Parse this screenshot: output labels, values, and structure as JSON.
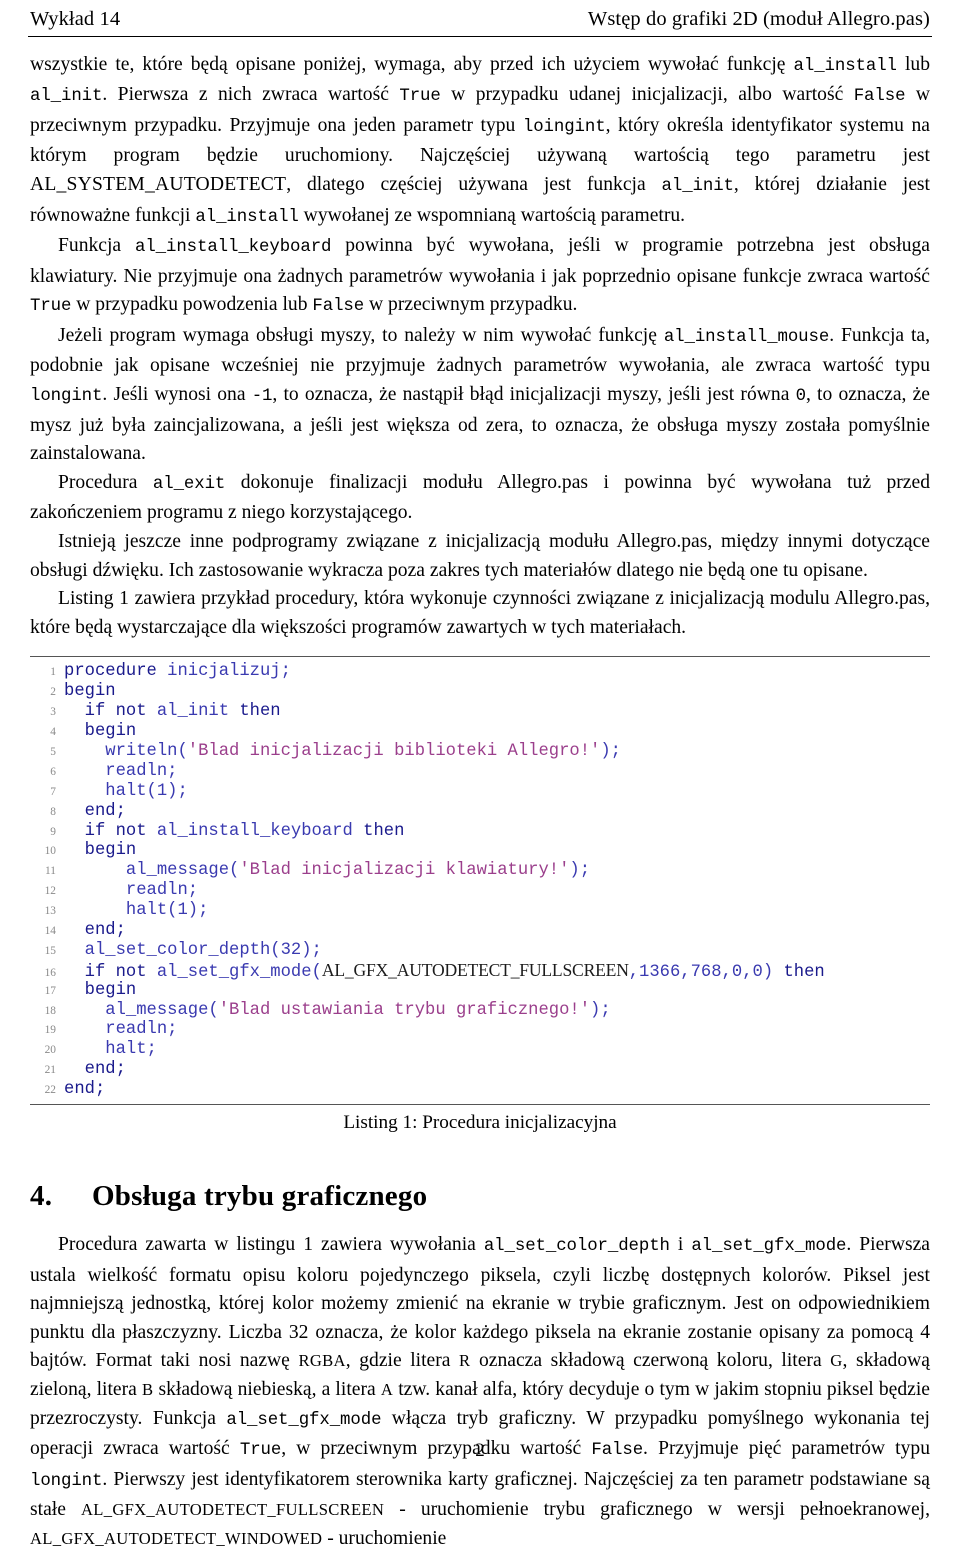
{
  "header": {
    "left": "Wykład 14",
    "right": "Wstęp do grafiki 2D (moduł Allegro.pas)"
  },
  "paragraphs": {
    "p1_a": "wszystkie te, które będą opisane poniżej, wymaga, aby przed ich użyciem wywołać funkcję ",
    "p1_code1": "al_install",
    "p1_b": " lub ",
    "p1_code2": "al_init",
    "p1_c": ". Pierwsza z nich zwraca wartość ",
    "p1_code3": "True",
    "p1_d": " w przypadku udanej inicjalizacji, albo wartość ",
    "p1_code4": "False",
    "p1_e": " w przeciwnym przypadku. Przyjmuje ona jeden parametr typu ",
    "p1_code5": "loingint",
    "p1_f": ", który określa identyfikator systemu na którym program będzie uruchomiony. Najczęściej używaną wartością tego parametru jest ",
    "p1_sc1": "AL_SYSTEM_AUTODETECT",
    "p1_g": ", dlatego częściej używana jest funkcja ",
    "p1_code6": "al_init",
    "p1_h": ", której działanie jest równoważne funkcji ",
    "p1_code7": "al_install",
    "p1_i": " wywołanej ze wspomnianą wartością parametru.",
    "p2_a": "Funkcja ",
    "p2_code1": "al_install_keyboard",
    "p2_b": " powinna być wywołana, jeśli w programie potrzebna jest obsługa klawiatury. Nie przyjmuje ona żadnych parametrów wywołania i jak poprzednio opisane funkcje zwraca wartość ",
    "p2_code2": "True",
    "p2_c": " w przypadku powodzenia lub ",
    "p2_code3": "False",
    "p2_d": " w przeciwnym przypadku.",
    "p3_a": "Jeżeli program wymaga obsługi myszy, to należy w nim wywołać funkcję ",
    "p3_code1": "al_install_mouse",
    "p3_b": ". Funkcja ta, podobnie jak opisane wcześniej nie przyjmuje żadnych parametrów wywołania, ale zwraca wartość typu ",
    "p3_code2": "longint",
    "p3_c": ". Jeśli wynosi ona ",
    "p3_code3": "-1",
    "p3_d": ", to oznacza, że nastąpił błąd inicjalizacji myszy, jeśli jest równa ",
    "p3_code4": "0",
    "p3_e": ", to oznacza, że mysz już była zaincjalizowana, a jeśli jest większa od zera, to oznacza, że obsługa myszy została pomyślnie zainstalowana.",
    "p4_a": "Procedura ",
    "p4_code1": "al_exit",
    "p4_b": " dokonuje finalizacji modułu Allegro.pas i powinna być wywołana tuż przed zakończeniem programu z niego korzystającego.",
    "p5": "Istnieją jeszcze inne podprogramy związane z inicjalizacją modułu Allegro.pas, między innymi dotyczące obsługi dźwięku. Ich zastosowanie wykracza poza zakres tych materiałów dlatego nie będą one tu opisane.",
    "p6": "Listing 1 zawiera przykład procedury, która wykonuje czynności związane z inicjalizacją modulu Allegro.pas, które będą wystarczające dla większości programów zawartych w tych materiałach."
  },
  "listing": {
    "caption": "Listing 1: Procedura inicjalizacyjna",
    "lines": [
      {
        "n": "1",
        "parts": [
          {
            "t": "procedure",
            "c": "kw"
          },
          {
            "t": " inicjalizuj;",
            "c": "idn"
          }
        ]
      },
      {
        "n": "2",
        "parts": [
          {
            "t": "begin",
            "c": "kw"
          }
        ]
      },
      {
        "n": "3",
        "parts": [
          {
            "t": "  ",
            "c": "pln"
          },
          {
            "t": "if not",
            "c": "kw"
          },
          {
            "t": " al_init ",
            "c": "idn"
          },
          {
            "t": "then",
            "c": "kw"
          }
        ]
      },
      {
        "n": "4",
        "parts": [
          {
            "t": "  ",
            "c": "pln"
          },
          {
            "t": "begin",
            "c": "kw"
          }
        ]
      },
      {
        "n": "5",
        "parts": [
          {
            "t": "    ",
            "c": "pln"
          },
          {
            "t": "writeln(",
            "c": "idn"
          },
          {
            "t": "'Blad inicjalizacji biblioteki Allegro!'",
            "c": "str"
          },
          {
            "t": ");",
            "c": "idn"
          }
        ]
      },
      {
        "n": "6",
        "parts": [
          {
            "t": "    ",
            "c": "pln"
          },
          {
            "t": "readln;",
            "c": "idn"
          }
        ]
      },
      {
        "n": "7",
        "parts": [
          {
            "t": "    ",
            "c": "pln"
          },
          {
            "t": "halt(1);",
            "c": "idn"
          }
        ]
      },
      {
        "n": "8",
        "parts": [
          {
            "t": "  ",
            "c": "pln"
          },
          {
            "t": "end;",
            "c": "kw"
          }
        ]
      },
      {
        "n": "9",
        "parts": [
          {
            "t": "  ",
            "c": "pln"
          },
          {
            "t": "if not",
            "c": "kw"
          },
          {
            "t": " al_install_keyboard ",
            "c": "idn"
          },
          {
            "t": "then",
            "c": "kw"
          }
        ]
      },
      {
        "n": "10",
        "parts": [
          {
            "t": "  ",
            "c": "pln"
          },
          {
            "t": "begin",
            "c": "kw"
          }
        ]
      },
      {
        "n": "11",
        "parts": [
          {
            "t": "      ",
            "c": "pln"
          },
          {
            "t": "al_message(",
            "c": "idn"
          },
          {
            "t": "'Blad inicjalizacji klawiatury!'",
            "c": "str"
          },
          {
            "t": ");",
            "c": "idn"
          }
        ]
      },
      {
        "n": "12",
        "parts": [
          {
            "t": "      ",
            "c": "pln"
          },
          {
            "t": "readln;",
            "c": "idn"
          }
        ]
      },
      {
        "n": "13",
        "parts": [
          {
            "t": "      ",
            "c": "pln"
          },
          {
            "t": "halt(1);",
            "c": "idn"
          }
        ]
      },
      {
        "n": "14",
        "parts": [
          {
            "t": "  ",
            "c": "pln"
          },
          {
            "t": "end;",
            "c": "kw"
          }
        ]
      },
      {
        "n": "15",
        "parts": [
          {
            "t": "  ",
            "c": "pln"
          },
          {
            "t": "al_set_color_depth(32);",
            "c": "idn"
          }
        ]
      },
      {
        "n": "16",
        "parts": [
          {
            "t": "  ",
            "c": "pln"
          },
          {
            "t": "if not",
            "c": "kw"
          },
          {
            "t": " al_set_gfx_mode(",
            "c": "idn"
          },
          {
            "t": "AL_GFX_AUTODETECT_FULLSCREEN",
            "c": "const"
          },
          {
            "t": ",1366,768,0,0)",
            "c": "idn"
          },
          {
            "t": " then",
            "c": "kw"
          }
        ]
      },
      {
        "n": "17",
        "parts": [
          {
            "t": "  ",
            "c": "pln"
          },
          {
            "t": "begin",
            "c": "kw"
          }
        ]
      },
      {
        "n": "18",
        "parts": [
          {
            "t": "    ",
            "c": "pln"
          },
          {
            "t": "al_message(",
            "c": "idn"
          },
          {
            "t": "'Blad ustawiania trybu graficznego!'",
            "c": "str"
          },
          {
            "t": ");",
            "c": "idn"
          }
        ]
      },
      {
        "n": "19",
        "parts": [
          {
            "t": "    ",
            "c": "pln"
          },
          {
            "t": "readln;",
            "c": "idn"
          }
        ]
      },
      {
        "n": "20",
        "parts": [
          {
            "t": "    ",
            "c": "pln"
          },
          {
            "t": "halt;",
            "c": "idn"
          }
        ]
      },
      {
        "n": "21",
        "parts": [
          {
            "t": "  ",
            "c": "pln"
          },
          {
            "t": "end;",
            "c": "kw"
          }
        ]
      },
      {
        "n": "22",
        "parts": [
          {
            "t": "end;",
            "c": "kw"
          }
        ]
      }
    ]
  },
  "section": {
    "number": "4.",
    "title": "Obsługa trybu graficznego",
    "p1_a": "Procedura zawarta w listingu 1 zawiera wywołania ",
    "p1_code1": "al_set_color_depth",
    "p1_b": " i ",
    "p1_code2": "al_set_gfx_mode",
    "p1_c": ". Pierwsza ustala wielkość formatu opisu koloru pojedynczego piksela, czyli liczbę dostępnych kolorów. Piksel jest najmniejszą jednostką, której kolor możemy zmienić na ekranie w trybie graficznym. Jest on odpowiednikiem punktu dla płaszczyzny. Liczba 32 oznacza, że kolor każdego piksela na ekranie zostanie opisany za pomocą 4 bajtów. Format taki nosi nazwę ",
    "p1_sc1": "RGBA",
    "p1_d": ", gdzie litera ",
    "p1_sc2": "R",
    "p1_e": " oznacza składową czerwoną koloru, litera ",
    "p1_sc3": "G",
    "p1_f": ", składową zieloną, litera ",
    "p1_sc4": "B",
    "p1_g": " składową niebieską, a litera ",
    "p1_sc5": "A",
    "p1_h": " tzw. kanał alfa, który decyduje o tym w jakim stopniu piksel będzie przezroczysty. Funkcja ",
    "p1_code3": "al_set_gfx_mode",
    "p1_i": " włącza tryb graficzny. W przypadku pomyślnego wykonania tej operacji zwraca wartość ",
    "p1_code4": "True",
    "p1_j": ", w przeciwnym przypadku wartość ",
    "p1_code5": "False",
    "p1_k": ". Przyjmuje pięć parametrów typu ",
    "p1_code6": "longint",
    "p1_l": ". Pierwszy jest identyfikatorem sterownika karty graficznej. Najczęściej za ten parametr podstawiane są stałe ",
    "p1_sc6": "AL_GFX_AUTODETECT_FULLSCREEN",
    "p1_m": " - uruchomienie trybu graficznego w wersji pełnoekranowej, ",
    "p1_sc7": "AL_GFX_AUTODETECT_WINDOWED",
    "p1_n": " - uruchomienie"
  },
  "footer": {
    "page_number": "2"
  },
  "colors": {
    "keyword": "#1a1a8c",
    "string": "#9b3f8c",
    "identifier": "#3a3ab0",
    "line_number": "#8a8a8a",
    "text": "#000000"
  }
}
